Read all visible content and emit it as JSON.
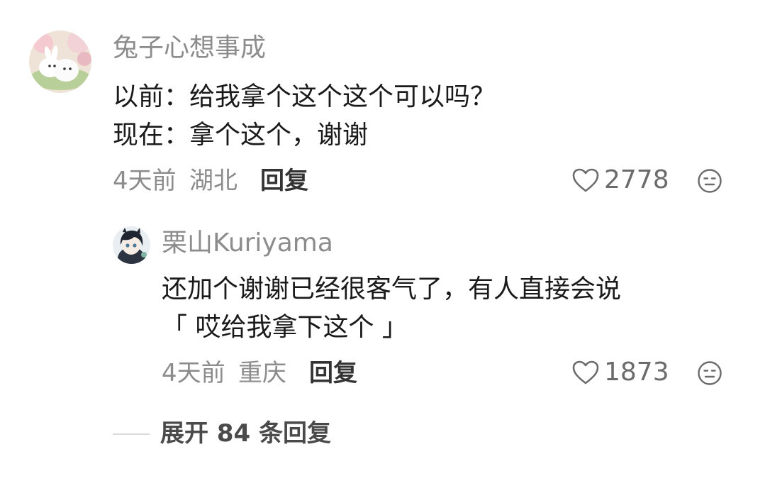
{
  "comment": {
    "username": "兔子心想事成",
    "lines": [
      "以前：给我拿个这个这个可以吗？",
      "现在：拿个这个，谢谢"
    ],
    "time": "4天前",
    "location": "湖北",
    "reply_label": "回复",
    "like_count": "2778"
  },
  "reply": {
    "username": "栗山Kuriyama",
    "lines": [
      "还加个谢谢已经很客气了，有人直接会说",
      "「 哎给我拿下这个 」"
    ],
    "time": "4天前",
    "location": "重庆",
    "reply_label": "回复",
    "like_count": "1873"
  },
  "expand": {
    "label": "展开 84 条回复"
  },
  "icons": {
    "like": "heart-outline-icon",
    "dislike": "neutral-face-icon"
  },
  "colors": {
    "username": "#8c8c8c",
    "text": "#1a1a1a",
    "meta": "#8c8c8c"
  }
}
